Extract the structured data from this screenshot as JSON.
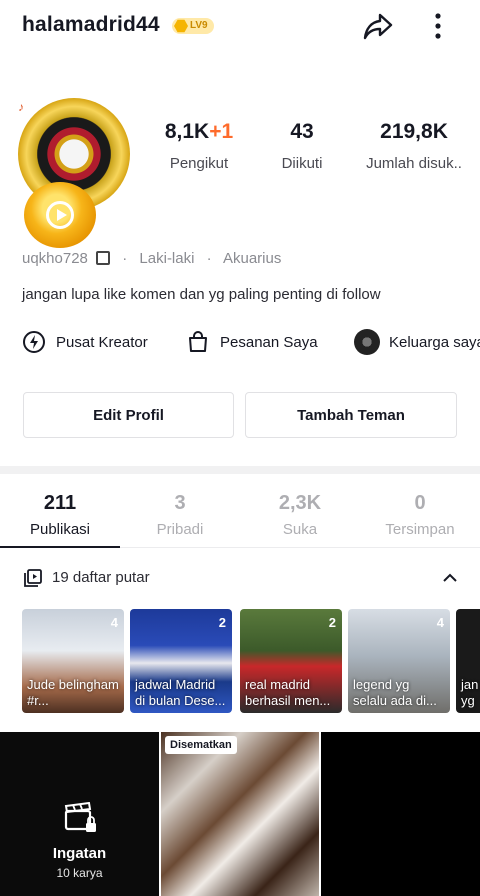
{
  "header": {
    "username": "halamadrid44",
    "level_badge": "LV9",
    "share_icon": "share-arrow-icon",
    "more_icon": "more-vertical-icon"
  },
  "profile": {
    "handle": "uqkho728",
    "gender": "Laki-laki",
    "zodiac": "Akuarius",
    "separator": "·",
    "bio": "jangan lupa like komen dan yg paling penting di follow"
  },
  "stats": {
    "followers": "8,1K",
    "followers_delta": "+1",
    "followers_label": "Pengikut",
    "following": "43",
    "following_label": "Diikuti",
    "likes": "219,8K",
    "likes_label": "Jumlah disuk.."
  },
  "links": {
    "creator": "Pusat Kreator",
    "orders": "Pesanan Saya",
    "family": "Keluarga saya"
  },
  "buttons": {
    "edit_profile": "Edit Profil",
    "add_friend": "Tambah Teman"
  },
  "tabs": [
    {
      "count": "211",
      "name": "Publikasi"
    },
    {
      "count": "3",
      "name": "Pribadi"
    },
    {
      "count": "2,3K",
      "name": "Suka"
    },
    {
      "count": "0",
      "name": "Tersimpan"
    }
  ],
  "playlists": {
    "title": "19 daftar putar",
    "items": [
      {
        "count": "4",
        "caption": "Jude belingham #r..."
      },
      {
        "count": "2",
        "caption": "jadwal Madrid di bulan Dese..."
      },
      {
        "count": "2",
        "caption": "real madrid berhasil men..."
      },
      {
        "count": "4",
        "caption": "legend yg selalu ada di..."
      },
      {
        "count": "",
        "caption": "jan yg"
      }
    ]
  },
  "grid": {
    "memory_title": "Ingatan",
    "memory_sub": "10 karya",
    "pinned_label": "Disematkan"
  },
  "colors": {
    "accent_orange": "#fe6b2c",
    "gold": "#f5b400",
    "text_primary": "#161823",
    "text_muted": "#8a8b91"
  }
}
